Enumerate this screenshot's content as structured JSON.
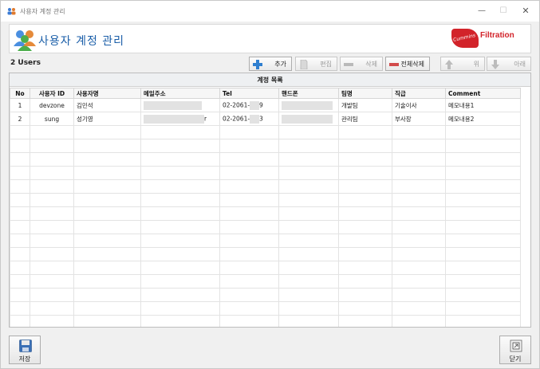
{
  "window": {
    "title": "사용자 계정 관리",
    "min_glyph": "—",
    "max_glyph": "☐",
    "close_glyph": "✕"
  },
  "header": {
    "title": "사용자 계정 관리",
    "logo_text": "Filtration",
    "logo_badge": "Cummins"
  },
  "toolbar": {
    "users_count": "2 Users",
    "add_label": "추가",
    "edit_label": "편집",
    "delete_label": "삭제",
    "delete_all_label": "전체삭제",
    "up_label": "위",
    "down_label": "아래"
  },
  "grid": {
    "caption": "계정 목록",
    "columns": [
      "No",
      "사용자 ID",
      "사용자명",
      "메일주소",
      "Tel",
      "핸드폰",
      "팀명",
      "직급",
      "Comment"
    ],
    "rows": [
      {
        "no": "1",
        "user_id": "devzone",
        "name": "김민석",
        "email": "",
        "tel_a": "02-2061-",
        "tel_b": "9",
        "mobile": "",
        "team": "개발팀",
        "rank": "기술이사",
        "comment": "메모내용1"
      },
      {
        "no": "2",
        "user_id": "sung",
        "name": "성기영",
        "email_tail": "r",
        "tel_a": "02-2061-",
        "tel_b": "3",
        "mobile": "",
        "team": "관리팀",
        "rank": "부사장",
        "comment": "메모내용2"
      }
    ]
  },
  "footer": {
    "save_label": "저장",
    "close_label": "닫기"
  },
  "colors": {
    "accent": "#1a5ea8",
    "brand": "#d2232a",
    "add_icon": "#2f7fd0",
    "delete_icon": "#d24a4a"
  }
}
